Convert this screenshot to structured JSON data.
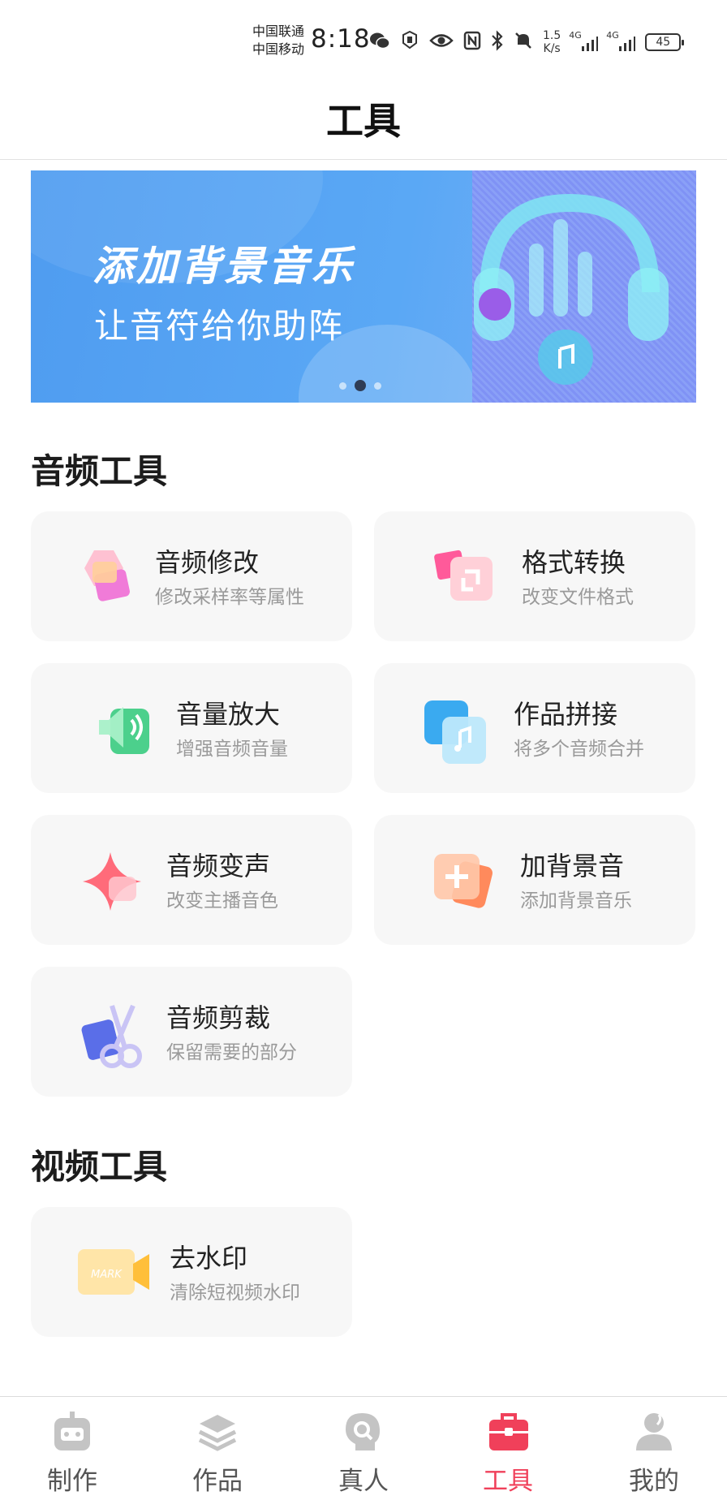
{
  "status_bar": {
    "carrier1": "中国联通",
    "carrier2": "中国移动",
    "time": "8:18",
    "net_speed_value": "1.5",
    "net_speed_unit": "K/s",
    "signal1_label": "4G",
    "signal2_label": "4G",
    "battery": "45"
  },
  "header": {
    "title": "工具"
  },
  "banner": {
    "title": "添加背景音乐",
    "subtitle": "让音符给你助阵",
    "page_count": 3,
    "active_page": 2
  },
  "audio_section": {
    "title": "音频工具",
    "tools": [
      {
        "name": "音频修改",
        "desc": "修改采样率等属性",
        "icon": "audio-edit-icon"
      },
      {
        "name": "格式转换",
        "desc": "改变文件格式",
        "icon": "format-convert-icon"
      },
      {
        "name": "音量放大",
        "desc": "增强音频音量",
        "icon": "volume-boost-icon"
      },
      {
        "name": "作品拼接",
        "desc": "将多个音频合并",
        "icon": "audio-merge-icon"
      },
      {
        "name": "音频变声",
        "desc": "改变主播音色",
        "icon": "voice-change-icon"
      },
      {
        "name": "加背景音",
        "desc": "添加背景音乐",
        "icon": "add-bgm-icon"
      },
      {
        "name": "音频剪裁",
        "desc": "保留需要的部分",
        "icon": "audio-trim-icon"
      }
    ]
  },
  "video_section": {
    "title": "视频工具",
    "tools": [
      {
        "name": "去水印",
        "desc": "清除短视频水印",
        "icon": "remove-watermark-icon",
        "icon_text": "MARK"
      }
    ]
  },
  "bottom_nav": {
    "items": [
      {
        "label": "制作",
        "icon": "robot-icon"
      },
      {
        "label": "作品",
        "icon": "layers-icon"
      },
      {
        "label": "真人",
        "icon": "human-voice-icon"
      },
      {
        "label": "工具",
        "icon": "toolbox-icon",
        "active": true
      },
      {
        "label": "我的",
        "icon": "user-icon"
      }
    ],
    "active_color": "#f0405a",
    "inactive_color": "#555555"
  }
}
